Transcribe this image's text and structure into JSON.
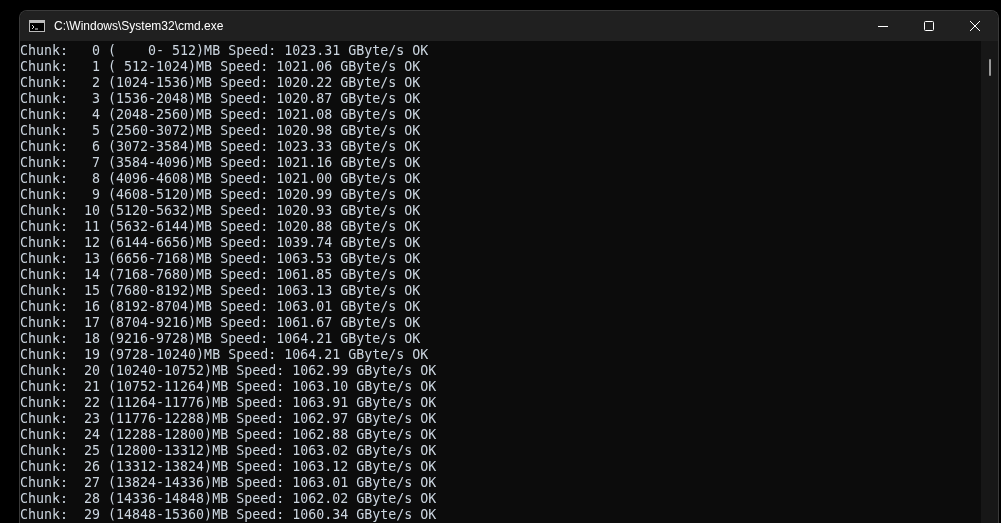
{
  "window": {
    "title": "C:\\Windows\\System32\\cmd.exe"
  },
  "console": {
    "lines": [
      "Chunk:   0 (    0- 512)MB Speed: 1023.31 GByte/s OK",
      "Chunk:   1 ( 512-1024)MB Speed: 1021.06 GByte/s OK",
      "Chunk:   2 (1024-1536)MB Speed: 1020.22 GByte/s OK",
      "Chunk:   3 (1536-2048)MB Speed: 1020.87 GByte/s OK",
      "Chunk:   4 (2048-2560)MB Speed: 1021.08 GByte/s OK",
      "Chunk:   5 (2560-3072)MB Speed: 1020.98 GByte/s OK",
      "Chunk:   6 (3072-3584)MB Speed: 1023.33 GByte/s OK",
      "Chunk:   7 (3584-4096)MB Speed: 1021.16 GByte/s OK",
      "Chunk:   8 (4096-4608)MB Speed: 1021.00 GByte/s OK",
      "Chunk:   9 (4608-5120)MB Speed: 1020.99 GByte/s OK",
      "Chunk:  10 (5120-5632)MB Speed: 1020.93 GByte/s OK",
      "Chunk:  11 (5632-6144)MB Speed: 1020.88 GByte/s OK",
      "Chunk:  12 (6144-6656)MB Speed: 1039.74 GByte/s OK",
      "Chunk:  13 (6656-7168)MB Speed: 1063.53 GByte/s OK",
      "Chunk:  14 (7168-7680)MB Speed: 1061.85 GByte/s OK",
      "Chunk:  15 (7680-8192)MB Speed: 1063.13 GByte/s OK",
      "Chunk:  16 (8192-8704)MB Speed: 1063.01 GByte/s OK",
      "Chunk:  17 (8704-9216)MB Speed: 1061.67 GByte/s OK",
      "Chunk:  18 (9216-9728)MB Speed: 1064.21 GByte/s OK",
      "Chunk:  19 (9728-10240)MB Speed: 1064.21 GByte/s OK",
      "Chunk:  20 (10240-10752)MB Speed: 1062.99 GByte/s OK",
      "Chunk:  21 (10752-11264)MB Speed: 1063.10 GByte/s OK",
      "Chunk:  22 (11264-11776)MB Speed: 1063.91 GByte/s OK",
      "Chunk:  23 (11776-12288)MB Speed: 1062.97 GByte/s OK",
      "Chunk:  24 (12288-12800)MB Speed: 1062.88 GByte/s OK",
      "Chunk:  25 (12800-13312)MB Speed: 1063.02 GByte/s OK",
      "Chunk:  26 (13312-13824)MB Speed: 1063.12 GByte/s OK",
      "Chunk:  27 (13824-14336)MB Speed: 1063.01 GByte/s OK",
      "Chunk:  28 (14336-14848)MB Speed: 1062.02 GByte/s OK",
      "Chunk:  29 (14848-15360)MB Speed: 1060.34 GByte/s OK"
    ]
  }
}
